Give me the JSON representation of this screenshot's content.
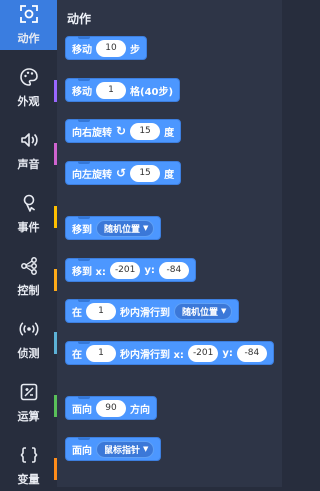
{
  "palette_title": "动作",
  "categories": [
    {
      "label": "动作",
      "icon": "motion-icon",
      "color": "#4c97ff",
      "active": true
    },
    {
      "label": "外观",
      "icon": "looks-icon",
      "color": "#9966ff"
    },
    {
      "label": "声音",
      "icon": "sound-icon",
      "color": "#cf63cf"
    },
    {
      "label": "事件",
      "icon": "events-icon",
      "color": "#ffbf00"
    },
    {
      "label": "控制",
      "icon": "control-icon",
      "color": "#ffab19"
    },
    {
      "label": "侦测",
      "icon": "sensing-icon",
      "color": "#5cb1d6"
    },
    {
      "label": "运算",
      "icon": "operators-icon",
      "color": "#59c059"
    },
    {
      "label": "变量",
      "icon": "variables-icon",
      "color": "#ff8c1a"
    }
  ],
  "blocks": {
    "move": {
      "label": "移动",
      "value": "10",
      "unit": "步"
    },
    "move_grid": {
      "label": "移动",
      "value": "1",
      "unit": "格(40步)"
    },
    "turn_right": {
      "label": "向右旋转",
      "value": "15",
      "unit": "度"
    },
    "turn_left": {
      "label": "向左旋转",
      "value": "15",
      "unit": "度"
    },
    "goto": {
      "label": "移到",
      "dropdown": "随机位置"
    },
    "goto_xy": {
      "label": "移到 x:",
      "x": "-201",
      "ylabel": "y:",
      "y": "-84"
    },
    "glide": {
      "label": "在",
      "secs": "1",
      "mid": "秒内滑行到",
      "dropdown": "随机位置"
    },
    "glide_xy": {
      "label": "在",
      "secs": "1",
      "mid": "秒内滑行到 x:",
      "x": "-201",
      "ylabel": "y:",
      "y": "-84"
    },
    "point_dir": {
      "label": "面向",
      "value": "90",
      "unit": "方向"
    },
    "point_towards": {
      "label": "面向",
      "dropdown": "鼠标指针"
    }
  }
}
